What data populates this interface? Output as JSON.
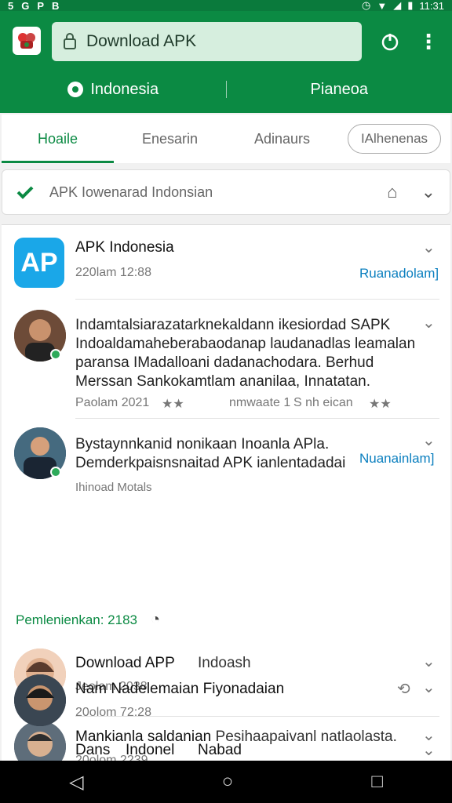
{
  "status": {
    "time": "11:31",
    "left_icons": [
      "5",
      "G",
      "P",
      "B"
    ]
  },
  "toolbar": {
    "url": "Download APK",
    "region_left": "Indonesia",
    "region_right": "Pianeoa"
  },
  "tabs": [
    "Hoaile",
    "Enesarin",
    "Adinaurs",
    "IAlhenenas"
  ],
  "verify": {
    "text": "APK Iowenarad Indonsian"
  },
  "feed": [
    {
      "type": "app",
      "title": "APK Indonesia",
      "meta": "220lam 12:88",
      "link": "Ruanadolam]"
    },
    {
      "type": "post",
      "body": "Indamtalsiarazatarknekaldann ikesiordad SAPK Indoaldamaheberabaodanap laudanadlas leamalan paransa IMadalloani dadanachodara. Berhud Merssan Sankokamtlam ananilaa, Innatatan.",
      "meta": "Paolam 2021",
      "meta_mid": "nmwaate 1",
      "meta_right": "S nh eican"
    },
    {
      "type": "post",
      "body": "Bystaynnkanid nonikaan Inoanla APla. Demderkpaisnsnaitad APK ianlentadadai",
      "sub": "Ihinoad Motals",
      "link": "Nuanainlam]"
    },
    {
      "type": "label",
      "text": "Pemlenienkan: 2183"
    },
    {
      "type": "post",
      "title": "Download APP",
      "title_suffix": "Indoash",
      "meta": "Jeolam 2038"
    },
    {
      "type": "post",
      "title": "Mankianla saldanian",
      "title_suffix": "Pesihaapaivanl natlaolasta.",
      "meta": "20olom 2239"
    },
    {
      "type": "post",
      "title": "Nam Nadelemaian Fiyonadaian",
      "meta": "20olom 72:28"
    },
    {
      "type": "post",
      "title": "Dans",
      "title_mid": "Indonel",
      "title_suffix": "Nabad"
    }
  ]
}
